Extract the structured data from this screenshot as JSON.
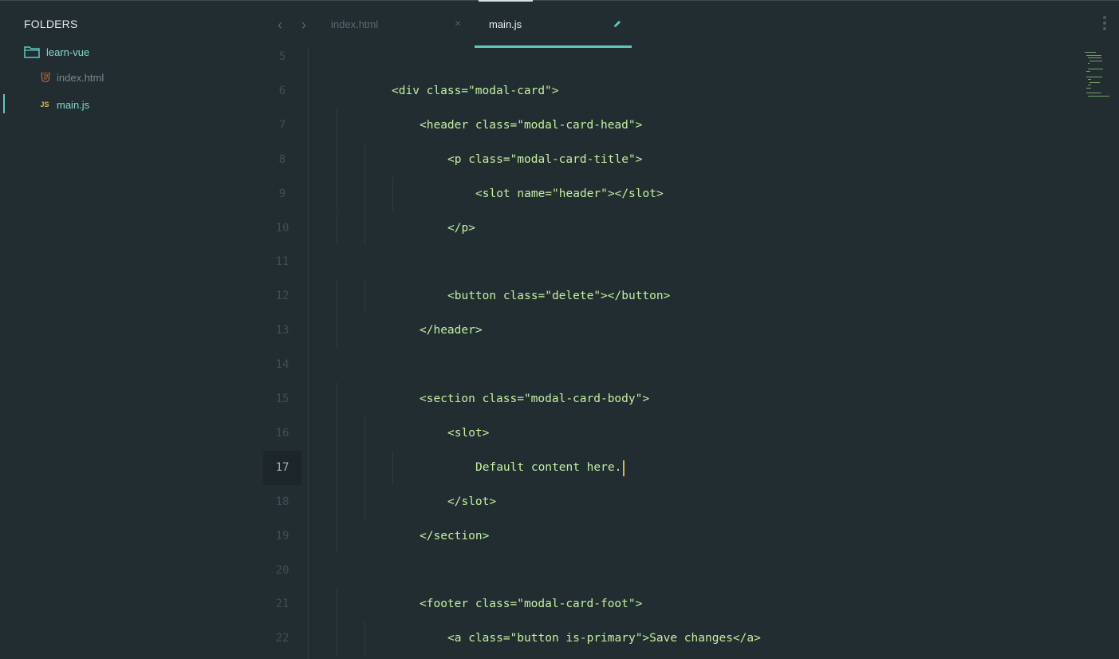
{
  "sidebar": {
    "title": "FOLDERS",
    "folder": {
      "label": "learn-vue",
      "icon": "folder-icon"
    },
    "files": [
      {
        "label": "index.html",
        "badge": "",
        "icon": "html5-icon",
        "active": false
      },
      {
        "label": "main.js",
        "badge": "JS",
        "icon": "js-icon",
        "active": true
      }
    ]
  },
  "tabs": [
    {
      "label": "index.html",
      "action": "close",
      "active": false
    },
    {
      "label": "main.js",
      "action": "edit",
      "active": true
    }
  ],
  "editor": {
    "current_line": 17,
    "lines": [
      {
        "num": "5",
        "indent": 0,
        "text": ""
      },
      {
        "num": "6",
        "indent": 1,
        "text": "<div class=\"modal-card\">"
      },
      {
        "num": "7",
        "indent": 2,
        "text": "<header class=\"modal-card-head\">"
      },
      {
        "num": "8",
        "indent": 3,
        "text": "<p class=\"modal-card-title\">"
      },
      {
        "num": "9",
        "indent": 4,
        "text": "<slot name=\"header\"></slot>"
      },
      {
        "num": "10",
        "indent": 3,
        "text": "</p>"
      },
      {
        "num": "11",
        "indent": 0,
        "text": ""
      },
      {
        "num": "12",
        "indent": 3,
        "text": "<button class=\"delete\"></button>"
      },
      {
        "num": "13",
        "indent": 2,
        "text": "</header>"
      },
      {
        "num": "14",
        "indent": 0,
        "text": ""
      },
      {
        "num": "15",
        "indent": 2,
        "text": "<section class=\"modal-card-body\">"
      },
      {
        "num": "16",
        "indent": 3,
        "text": "<slot>"
      },
      {
        "num": "17",
        "indent": 4,
        "text": "Default content here."
      },
      {
        "num": "18",
        "indent": 3,
        "text": "</slot>"
      },
      {
        "num": "19",
        "indent": 2,
        "text": "</section>"
      },
      {
        "num": "20",
        "indent": 0,
        "text": ""
      },
      {
        "num": "21",
        "indent": 2,
        "text": "<footer class=\"modal-card-foot\">"
      },
      {
        "num": "22",
        "indent": 3,
        "text": "<a class=\"button is-primary\">Save changes</a>"
      }
    ]
  },
  "colors": {
    "background": "#222d32",
    "accent": "#5fc8c0",
    "code": "#c3f09e",
    "cursor": "#e0b24e"
  }
}
